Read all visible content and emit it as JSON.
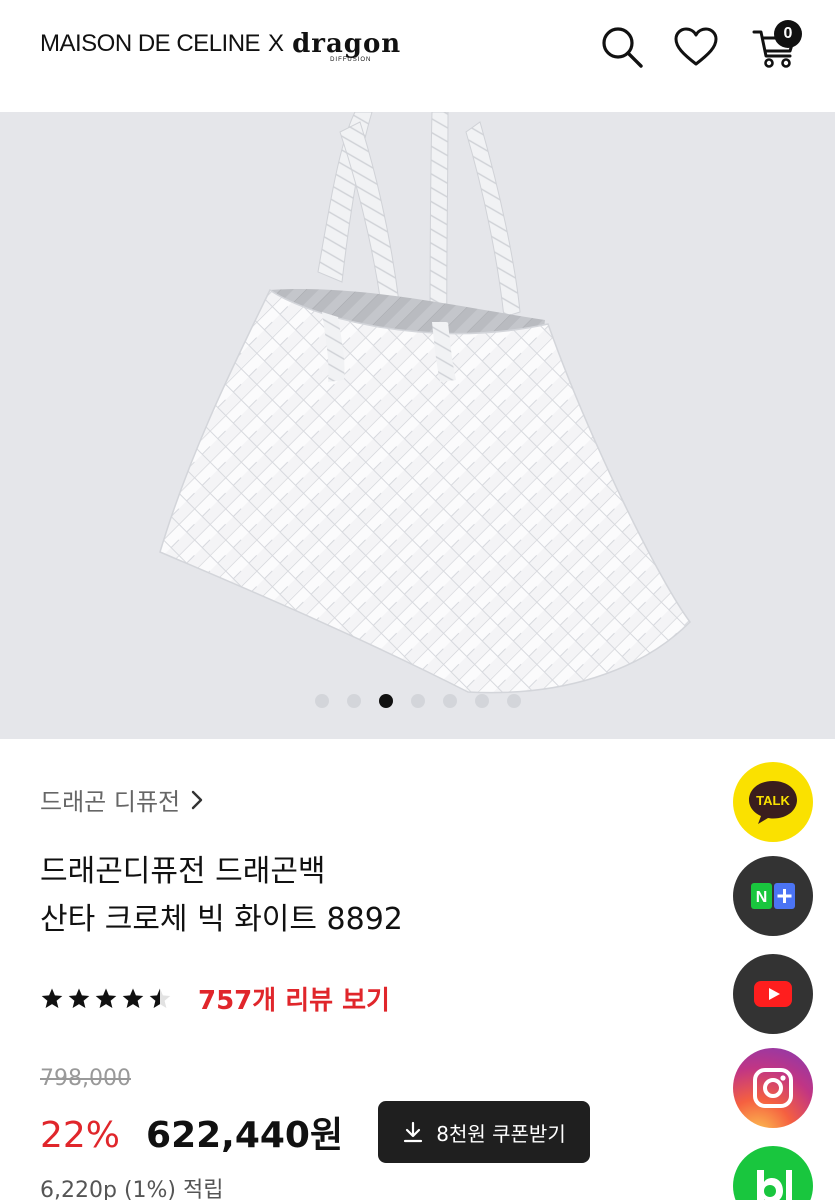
{
  "header": {
    "brand_left": "MAISON DE CELINE",
    "brand_x": "X",
    "brand_logo": "dragon",
    "brand_logo_sub": "DIFFUSION",
    "icons": [
      "search-icon",
      "heart-icon",
      "cart-icon"
    ],
    "cart_count": "0"
  },
  "hero": {
    "slide_count": 7,
    "active_slide": 3
  },
  "product": {
    "breadcrumb": "드래곤 디퓨전",
    "title_line1": "드래곤디퓨전 드래곤백",
    "title_line2": "산타 크로체 빅 화이트 8892",
    "rating": 4.5,
    "review_link": "757개 리뷰 보기",
    "original_price": "798,000",
    "discount": "22%",
    "price": "622,440원",
    "coupon_button": "8천원 쿠폰받기",
    "points": "6,220p (1%) 적립"
  },
  "side_buttons": {
    "talk_label": "TALK",
    "naver_label": "N",
    "icons": [
      "kakaotalk-icon",
      "naver-plus-icon",
      "youtube-icon",
      "instagram-icon",
      "blog-icon"
    ]
  },
  "colors": {
    "accent_red": "#e0262b",
    "kakao_yellow": "#fae100",
    "naver_green": "#19c63e",
    "hero_bg": "#e5e6ea"
  }
}
